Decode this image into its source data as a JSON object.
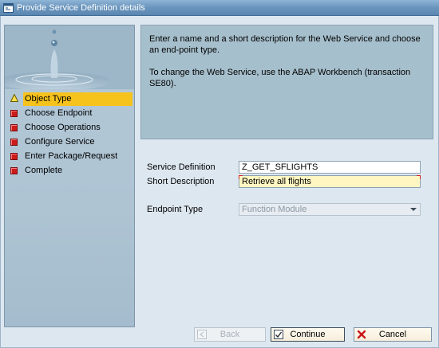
{
  "window": {
    "title": "Provide Service Definition details"
  },
  "steps": [
    {
      "label": "Object Type",
      "icon": "warning-triangle-icon",
      "active": true
    },
    {
      "label": "Choose Endpoint",
      "icon": "red-square-icon",
      "active": false
    },
    {
      "label": "Choose Operations",
      "icon": "red-square-icon",
      "active": false
    },
    {
      "label": "Configure Service",
      "icon": "red-square-icon",
      "active": false
    },
    {
      "label": "Enter Package/Request",
      "icon": "red-square-icon",
      "active": false
    },
    {
      "label": "Complete",
      "icon": "red-square-icon",
      "active": false
    }
  ],
  "info": {
    "paragraph1": "Enter a name and a short description for the Web Service and choose an end-point type.",
    "paragraph2": "To change the Web Service, use the ABAP Workbench (transaction SE80)."
  },
  "form": {
    "service_definition": {
      "label": "Service Definition",
      "value": "Z_GET_SFLIGHTS"
    },
    "short_description": {
      "label": "Short Description",
      "value": "Retrieve all flights"
    },
    "endpoint_type": {
      "label": "Endpoint Type",
      "value": "Function Module"
    }
  },
  "buttons": {
    "back": "Back",
    "continue": "Continue",
    "cancel": "Cancel"
  },
  "colors": {
    "active_step": "#f6c21c",
    "required_field": "#fff6c2",
    "title_bar": "#6a95bd"
  }
}
